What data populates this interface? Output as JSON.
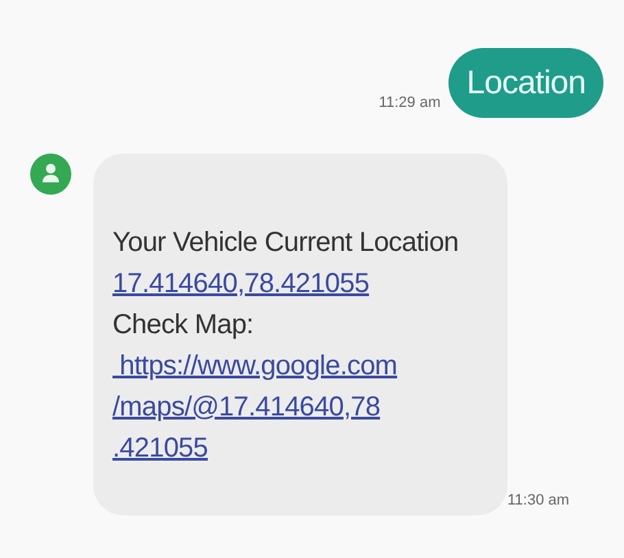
{
  "messages": [
    {
      "kind": "sent",
      "text": "Location",
      "time": "11:29 am"
    },
    {
      "kind": "received",
      "time": "11:30 am",
      "lines": [
        {
          "kind": "text",
          "text": "Your Vehicle Current Location"
        },
        {
          "kind": "link",
          "text": "17.414640,78.421055"
        },
        {
          "kind": "text",
          "text": "Check Map:"
        },
        {
          "kind": "link",
          "text": " https://www.google.com"
        },
        {
          "kind": "link",
          "text": "/maps/@17.414640,78"
        },
        {
          "kind": "link",
          "text": ".421055"
        }
      ]
    }
  ]
}
